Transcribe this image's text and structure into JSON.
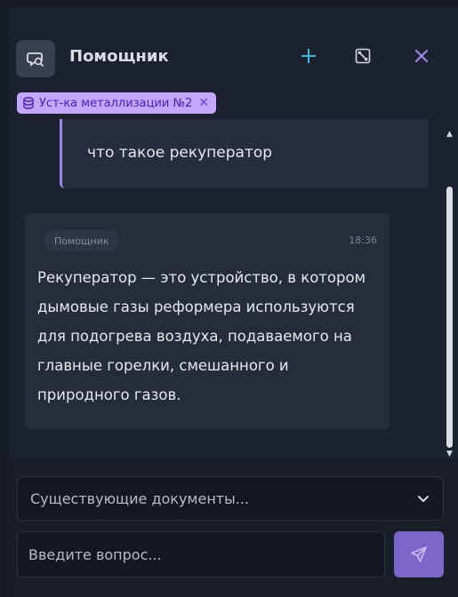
{
  "header": {
    "title": "Помощник",
    "avatar_icon": "chat-bubble-icon",
    "add_icon": "plus-icon",
    "expand_icon": "expand-icon",
    "close_icon": "close-icon"
  },
  "context_tag": {
    "label": "Уст-ка металлизации №2",
    "icon": "database-icon",
    "close_label": "✕"
  },
  "messages": {
    "user": {
      "text": "что такое рекуператор"
    },
    "assistant": {
      "role_label": "Помощник",
      "time": "18:36",
      "text": "Рекуператор — это устройство, в котором дымовые газы реформера используются для подогрева воздуха, подаваемого на главные горелки, смешанного и природного газов."
    }
  },
  "documents_select": {
    "placeholder": "Существующие документы...",
    "icon": "chevron-down-icon"
  },
  "question_input": {
    "placeholder": "Введите вопрос...",
    "value": ""
  },
  "send_button": {
    "icon": "send-icon"
  },
  "colors": {
    "accent": "#9b85e8",
    "tag_bg": "#c3a7ff",
    "send_bg": "#7b66c9",
    "add_icon": "#3fb8d8",
    "close_icon": "#9b85e8"
  }
}
